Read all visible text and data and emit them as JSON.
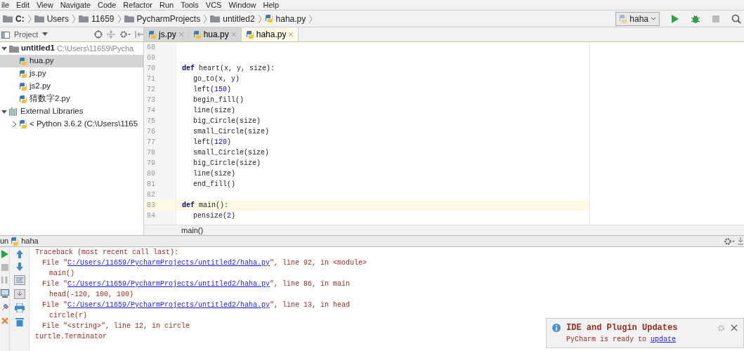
{
  "menu": [
    "ile",
    "Edit",
    "View",
    "Navigate",
    "Code",
    "Refactor",
    "Run",
    "Tools",
    "VCS",
    "Window",
    "Help"
  ],
  "breadcrumbs": [
    {
      "label": "C:",
      "kind": "drive"
    },
    {
      "label": "Users",
      "kind": "folder"
    },
    {
      "label": "11659",
      "kind": "folder"
    },
    {
      "label": "PycharmProjects",
      "kind": "folder"
    },
    {
      "label": "untitled2",
      "kind": "folder"
    },
    {
      "label": "haha.py",
      "kind": "file"
    }
  ],
  "run_config": "haha",
  "project_panel": {
    "title": "Project",
    "tree": [
      {
        "label": "untitled1",
        "path": "C:\\Users\\11659\\Pycha",
        "kind": "folder",
        "expanded": true,
        "selected": false,
        "children": [
          {
            "label": "hua.py",
            "kind": "file",
            "selected": true
          },
          {
            "label": "js.py",
            "kind": "file",
            "selected": false
          },
          {
            "label": "js2.py",
            "kind": "file",
            "selected": false
          },
          {
            "label": "猜数字2.py",
            "kind": "file",
            "selected": false
          }
        ]
      },
      {
        "label": "External Libraries",
        "kind": "library",
        "expanded": true,
        "selected": false,
        "children": [
          {
            "label": "< Python 3.6.2 (C:\\Users\\1165",
            "kind": "sdk",
            "expanded": false,
            "selected": false
          }
        ]
      }
    ]
  },
  "editor_tabs": [
    {
      "label": "js.py",
      "selected": false
    },
    {
      "label": "hua.py",
      "selected": false
    },
    {
      "label": "haha.py",
      "selected": true
    }
  ],
  "code_lines": [
    {
      "number": "68",
      "kind": "top",
      "highlighted": false
    },
    {
      "number": "69",
      "kind": "top",
      "highlighted": false
    },
    {
      "number": "70",
      "kind": "top",
      "highlighted": false,
      "code": [
        {
          "text": "def",
          "kind": "keyword"
        },
        {
          "text": " heart(x, y, size):",
          "kind": "plain"
        }
      ]
    },
    {
      "number": "71",
      "kind": "body",
      "highlighted": false,
      "code": [
        {
          "text": "go_to(x, y)",
          "kind": "plain"
        }
      ]
    },
    {
      "number": "72",
      "kind": "body",
      "highlighted": false,
      "code": [
        {
          "text": "left(",
          "kind": "plain"
        },
        {
          "text": "150",
          "kind": "number"
        },
        {
          "text": ")",
          "kind": "plain"
        }
      ]
    },
    {
      "number": "73",
      "kind": "body",
      "highlighted": false,
      "code": [
        {
          "text": "begin_fill()",
          "kind": "plain"
        }
      ]
    },
    {
      "number": "74",
      "kind": "body",
      "highlighted": false,
      "code": [
        {
          "text": "line(size)",
          "kind": "plain"
        }
      ]
    },
    {
      "number": "75",
      "kind": "body",
      "highlighted": false,
      "code": [
        {
          "text": "big_Circle(size)",
          "kind": "plain"
        }
      ]
    },
    {
      "number": "76",
      "kind": "body",
      "highlighted": false,
      "code": [
        {
          "text": "small_Circle(size)",
          "kind": "plain"
        }
      ]
    },
    {
      "number": "77",
      "kind": "body",
      "highlighted": false,
      "code": [
        {
          "text": "left(",
          "kind": "plain"
        },
        {
          "text": "120",
          "kind": "number"
        },
        {
          "text": ")",
          "kind": "plain"
        }
      ]
    },
    {
      "number": "78",
      "kind": "body",
      "highlighted": false,
      "code": [
        {
          "text": "small_Circle(size)",
          "kind": "plain"
        }
      ]
    },
    {
      "number": "79",
      "kind": "body",
      "highlighted": false,
      "code": [
        {
          "text": "big_Circle(size)",
          "kind": "plain"
        }
      ]
    },
    {
      "number": "80",
      "kind": "body",
      "highlighted": false,
      "code": [
        {
          "text": "line(size)",
          "kind": "plain"
        }
      ]
    },
    {
      "number": "81",
      "kind": "body",
      "highlighted": false,
      "code": [
        {
          "text": "end_fill()",
          "kind": "plain"
        }
      ]
    },
    {
      "number": "82",
      "kind": "top",
      "highlighted": false
    },
    {
      "number": "83",
      "kind": "top",
      "highlighted": true,
      "code": [
        {
          "text": "def",
          "kind": "keyword"
        },
        {
          "text": " main():",
          "kind": "plain"
        }
      ]
    },
    {
      "number": "84",
      "kind": "body",
      "highlighted": false,
      "code": [
        {
          "text": "pensize(",
          "kind": "plain"
        },
        {
          "text": "2",
          "kind": "number"
        },
        {
          "text": ")",
          "kind": "plain"
        }
      ]
    }
  ],
  "editor_breadcrumb": "main()",
  "run_panel": {
    "title": "un",
    "config": "haha",
    "lines": [
      {
        "kind": "header",
        "text": "Traceback (most recent call last):"
      },
      {
        "kind": "file",
        "prefix": "File \"",
        "link": "C:/Users/11659/PycharmProjects/untitled2/haha.py",
        "suffix": "\", line 92, in <module>"
      },
      {
        "kind": "source",
        "text": "main()"
      },
      {
        "kind": "file",
        "prefix": "File \"",
        "link": "C:/Users/11659/PycharmProjects/untitled2/haha.py",
        "suffix": "\", line 86, in main"
      },
      {
        "kind": "source",
        "text": "head(-120, 100, 100)"
      },
      {
        "kind": "file",
        "prefix": "File \"",
        "link": "C:/Users/11659/PycharmProjects/untitled2/haha.py",
        "suffix": "\", line 13, in head"
      },
      {
        "kind": "source",
        "text": "circle(r)"
      },
      {
        "kind": "frame",
        "text": "File \"<string>\", line 12, in circle"
      },
      {
        "kind": "header",
        "text": "turtle.Terminator"
      }
    ]
  },
  "notification": {
    "title": "IDE and Plugin Updates",
    "body": "PyCharm is ready to ",
    "link": "update"
  }
}
